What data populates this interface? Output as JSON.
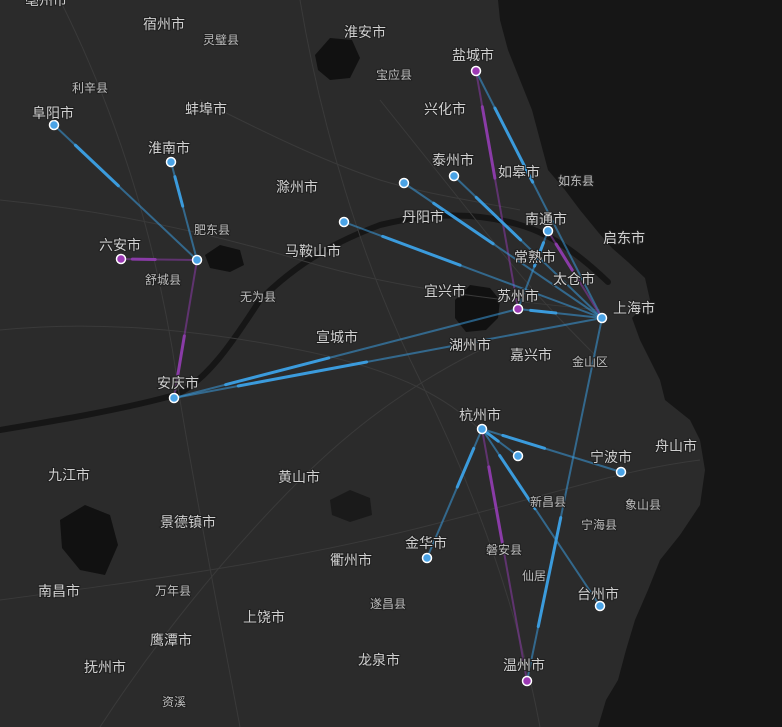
{
  "map": {
    "colors": {
      "land": "#2b2b2b",
      "sea": "#161616",
      "water": "#111111",
      "road": "#3d3d3d",
      "flow_blue": "#3b9bdc",
      "flow_purple": "#8a3ba7",
      "node_blue": "#4aa3e6",
      "node_purple": "#9c3ab4",
      "node_ring": "#ffffff"
    },
    "labels": [
      {
        "id": "bozhou",
        "text": "亳州市",
        "kind": "city"
      },
      {
        "id": "suzhou_ah",
        "text": "宿州市",
        "kind": "city"
      },
      {
        "id": "lingbi",
        "text": "灵璧县",
        "kind": "county"
      },
      {
        "id": "huaian",
        "text": "淮安市",
        "kind": "city"
      },
      {
        "id": "yancheng",
        "text": "盐城市",
        "kind": "city"
      },
      {
        "id": "baoying",
        "text": "宝应县",
        "kind": "county"
      },
      {
        "id": "lixin",
        "text": "利辛县",
        "kind": "county"
      },
      {
        "id": "fuyang",
        "text": "阜阳市",
        "kind": "city"
      },
      {
        "id": "bengbu",
        "text": "蚌埠市",
        "kind": "city"
      },
      {
        "id": "xinghua",
        "text": "兴化市",
        "kind": "city"
      },
      {
        "id": "huainan",
        "text": "淮南市",
        "kind": "city"
      },
      {
        "id": "taizhou_js",
        "text": "泰州市",
        "kind": "city"
      },
      {
        "id": "rugao",
        "text": "如皋市",
        "kind": "city"
      },
      {
        "id": "rudong",
        "text": "如东县",
        "kind": "county"
      },
      {
        "id": "chuzhou",
        "text": "滁州市",
        "kind": "city"
      },
      {
        "id": "danyang",
        "text": "丹阳市",
        "kind": "city"
      },
      {
        "id": "nantong",
        "text": "南通市",
        "kind": "city"
      },
      {
        "id": "feidong",
        "text": "肥东县",
        "kind": "county"
      },
      {
        "id": "luan",
        "text": "六安市",
        "kind": "city"
      },
      {
        "id": "maanshan",
        "text": "马鞍山市",
        "kind": "city"
      },
      {
        "id": "qidong",
        "text": "启东市",
        "kind": "city"
      },
      {
        "id": "changshu",
        "text": "常熟市",
        "kind": "city"
      },
      {
        "id": "shucheng",
        "text": "舒城县",
        "kind": "county"
      },
      {
        "id": "taicang",
        "text": "太仓市",
        "kind": "city"
      },
      {
        "id": "wuwei",
        "text": "无为县",
        "kind": "county"
      },
      {
        "id": "yixing",
        "text": "宜兴市",
        "kind": "city"
      },
      {
        "id": "suzhou_js",
        "text": "苏州市",
        "kind": "city"
      },
      {
        "id": "shanghai",
        "text": "上海市",
        "kind": "city"
      },
      {
        "id": "xuancheng",
        "text": "宣城市",
        "kind": "city"
      },
      {
        "id": "huzhou",
        "text": "湖州市",
        "kind": "city"
      },
      {
        "id": "jiaxing",
        "text": "嘉兴市",
        "kind": "city"
      },
      {
        "id": "jinshan",
        "text": "金山区",
        "kind": "county"
      },
      {
        "id": "anqing",
        "text": "安庆市",
        "kind": "city"
      },
      {
        "id": "hangzhou",
        "text": "杭州市",
        "kind": "city"
      },
      {
        "id": "zhoushan",
        "text": "舟山市",
        "kind": "city"
      },
      {
        "id": "ningbo",
        "text": "宁波市",
        "kind": "city"
      },
      {
        "id": "jiujiang",
        "text": "九江市",
        "kind": "city"
      },
      {
        "id": "huangshan",
        "text": "黄山市",
        "kind": "city"
      },
      {
        "id": "xinchang",
        "text": "新昌县",
        "kind": "county"
      },
      {
        "id": "xiangshan",
        "text": "象山县",
        "kind": "county"
      },
      {
        "id": "jingdezhen",
        "text": "景德镇市",
        "kind": "city"
      },
      {
        "id": "ninghai",
        "text": "宁海县",
        "kind": "county"
      },
      {
        "id": "jinhua",
        "text": "金华市",
        "kind": "city"
      },
      {
        "id": "quzhou",
        "text": "衢州市",
        "kind": "city"
      },
      {
        "id": "panan",
        "text": "磐安县",
        "kind": "county"
      },
      {
        "id": "nanchang",
        "text": "南昌市",
        "kind": "city"
      },
      {
        "id": "wannian",
        "text": "万年县",
        "kind": "county"
      },
      {
        "id": "xianju",
        "text": "仙居",
        "kind": "county"
      },
      {
        "id": "suichang",
        "text": "遂昌县",
        "kind": "county"
      },
      {
        "id": "taizhou_zj",
        "text": "台州市",
        "kind": "city"
      },
      {
        "id": "shangrao",
        "text": "上饶市",
        "kind": "city"
      },
      {
        "id": "yingtan",
        "text": "鹰潭市",
        "kind": "city"
      },
      {
        "id": "longquan",
        "text": "龙泉市",
        "kind": "city"
      },
      {
        "id": "wenzhou",
        "text": "温州市",
        "kind": "city"
      },
      {
        "id": "fuzhou_jx",
        "text": "抚州市",
        "kind": "city"
      },
      {
        "id": "zixi",
        "text": "资溪",
        "kind": "county"
      }
    ],
    "nodes": [
      {
        "id": "n_fuyang",
        "color": "blue"
      },
      {
        "id": "n_huainan",
        "color": "blue"
      },
      {
        "id": "n_luan",
        "color": "purple"
      },
      {
        "id": "n_hefei",
        "color": "blue"
      },
      {
        "id": "n_anqing",
        "color": "blue"
      },
      {
        "id": "n_yancheng",
        "color": "purple"
      },
      {
        "id": "n_yangzhou",
        "color": "blue"
      },
      {
        "id": "n_taizhou",
        "color": "blue"
      },
      {
        "id": "n_nanjing",
        "color": "blue"
      },
      {
        "id": "n_nantong",
        "color": "blue"
      },
      {
        "id": "n_suzhou",
        "color": "purple"
      },
      {
        "id": "n_shanghai",
        "color": "blue"
      },
      {
        "id": "n_hangzhou",
        "color": "blue"
      },
      {
        "id": "n_shaoxing",
        "color": "blue"
      },
      {
        "id": "n_ningbo",
        "color": "blue"
      },
      {
        "id": "n_jinhua",
        "color": "blue"
      },
      {
        "id": "n_taizhou_zj",
        "color": "blue"
      },
      {
        "id": "n_wenzhou",
        "color": "purple"
      }
    ],
    "flows": [
      {
        "from": "n_fuyang",
        "to": "n_hefei",
        "color": "blue"
      },
      {
        "from": "n_huainan",
        "to": "n_hefei",
        "color": "blue"
      },
      {
        "from": "n_luan",
        "to": "n_hefei",
        "color": "purple"
      },
      {
        "from": "n_anqing",
        "to": "n_hefei",
        "color": "purple"
      },
      {
        "from": "n_anqing",
        "to": "n_suzhou",
        "color": "blue"
      },
      {
        "from": "n_anqing",
        "to": "n_shanghai",
        "color": "blue"
      },
      {
        "from": "n_yancheng",
        "to": "n_suzhou",
        "color": "purple"
      },
      {
        "from": "n_yancheng",
        "to": "n_shanghai",
        "color": "blue"
      },
      {
        "from": "n_yangzhou",
        "to": "n_shanghai",
        "color": "blue"
      },
      {
        "from": "n_taizhou",
        "to": "n_shanghai",
        "color": "blue"
      },
      {
        "from": "n_nanjing",
        "to": "n_shanghai",
        "color": "blue"
      },
      {
        "from": "n_nantong",
        "to": "n_shanghai",
        "color": "purple"
      },
      {
        "from": "n_nantong",
        "to": "n_suzhou",
        "color": "blue"
      },
      {
        "from": "n_suzhou",
        "to": "n_shanghai",
        "color": "blue"
      },
      {
        "from": "n_hangzhou",
        "to": "n_ningbo",
        "color": "blue"
      },
      {
        "from": "n_hangzhou",
        "to": "n_shaoxing",
        "color": "blue"
      },
      {
        "from": "n_hangzhou",
        "to": "n_jinhua",
        "color": "blue"
      },
      {
        "from": "n_hangzhou",
        "to": "n_taizhou_zj",
        "color": "blue"
      },
      {
        "from": "n_hangzhou",
        "to": "n_wenzhou",
        "color": "purple"
      },
      {
        "from": "n_wenzhou",
        "to": "n_shanghai",
        "color": "blue"
      }
    ]
  }
}
